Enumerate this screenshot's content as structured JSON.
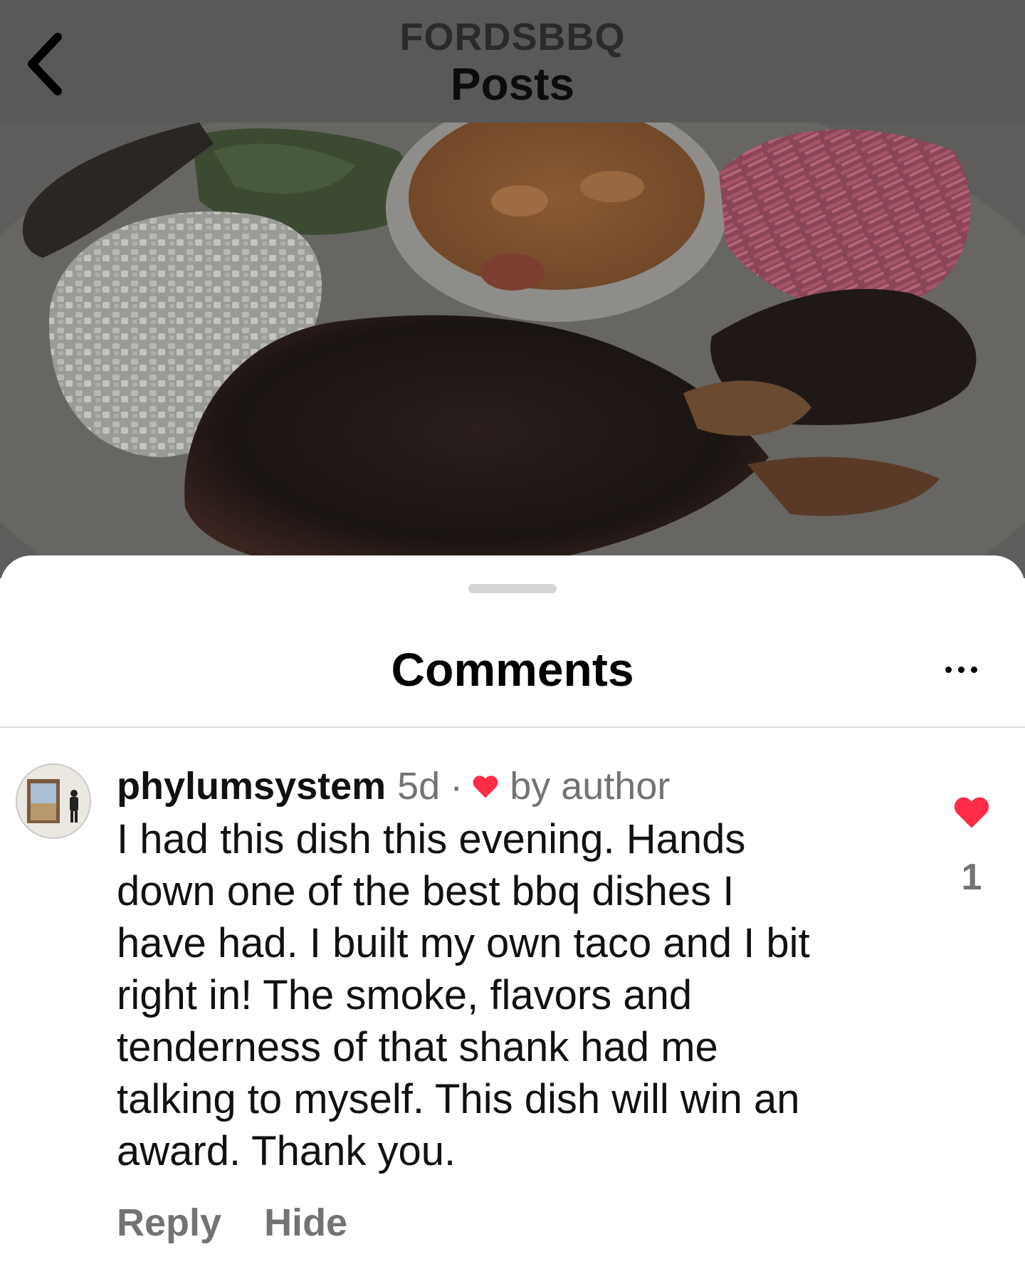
{
  "header": {
    "username": "FORDSBBQ",
    "title": "Posts",
    "back_icon": "chevron-left-icon"
  },
  "sheet": {
    "title": "Comments",
    "more_icon": "more-horizontal-icon"
  },
  "comment": {
    "username": "phylumsystem",
    "time": "5d",
    "separator": "·",
    "liked_by_author_label": "by author",
    "text_lines": [
      "I had this dish this evening. Hands",
      "down one of the best bbq dishes I",
      "have had. I built my own taco and I bit",
      "right in! The smoke, flavors and",
      "tenderness of that shank had me",
      "talking to myself. This dish will win an",
      "award. Thank you."
    ],
    "like_count": "1",
    "actions": {
      "reply": "Reply",
      "hide": "Hide"
    }
  },
  "colors": {
    "header_bg": "#595959",
    "heart": "#ff2d45",
    "muted_text": "#737373",
    "sheet_bg": "#ffffff"
  }
}
